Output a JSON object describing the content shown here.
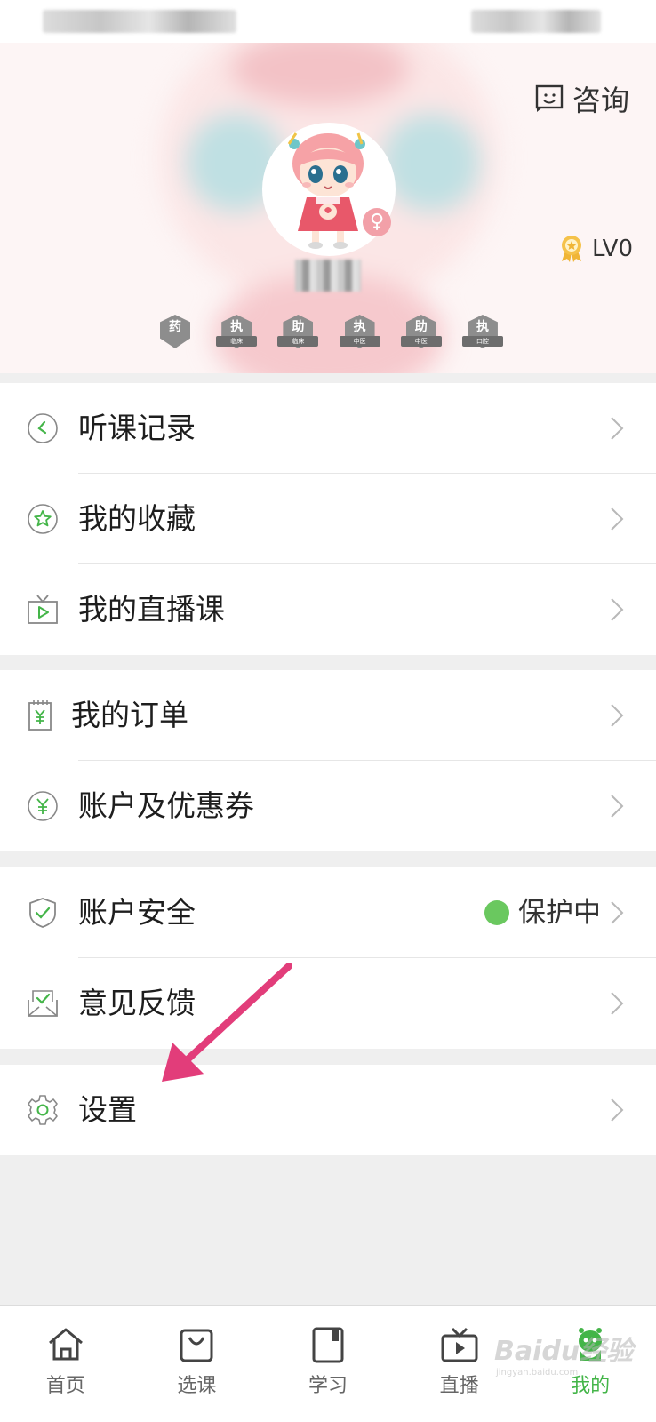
{
  "header": {
    "consult_label": "咨询",
    "level_label": "LV0",
    "gender_symbol": "♀",
    "badges": [
      {
        "main": "药",
        "sub": ""
      },
      {
        "main": "执",
        "sub": "临床"
      },
      {
        "main": "助",
        "sub": "临床"
      },
      {
        "main": "执",
        "sub": "中医"
      },
      {
        "main": "助",
        "sub": "中医"
      },
      {
        "main": "执",
        "sub": "口腔"
      }
    ]
  },
  "menu": {
    "group1": {
      "listen_history": "听课记录",
      "favorites": "我的收藏",
      "live_courses": "我的直播课"
    },
    "group2": {
      "orders": "我的订单",
      "account_coupons": "账户及优惠券"
    },
    "group3": {
      "account_security": "账户安全",
      "security_status": "保护中",
      "feedback": "意见反馈"
    },
    "group4": {
      "settings": "设置"
    }
  },
  "tabbar": {
    "home": "首页",
    "courses": "选课",
    "study": "学习",
    "live": "直播",
    "mine": "我的"
  },
  "watermark": {
    "brand": "Baidu经验",
    "url": "jingyan.baidu.com"
  },
  "colors": {
    "accent_green": "#44b549",
    "arrow_pink": "#e23d7a",
    "badge_gray": "#8d8d8d"
  }
}
